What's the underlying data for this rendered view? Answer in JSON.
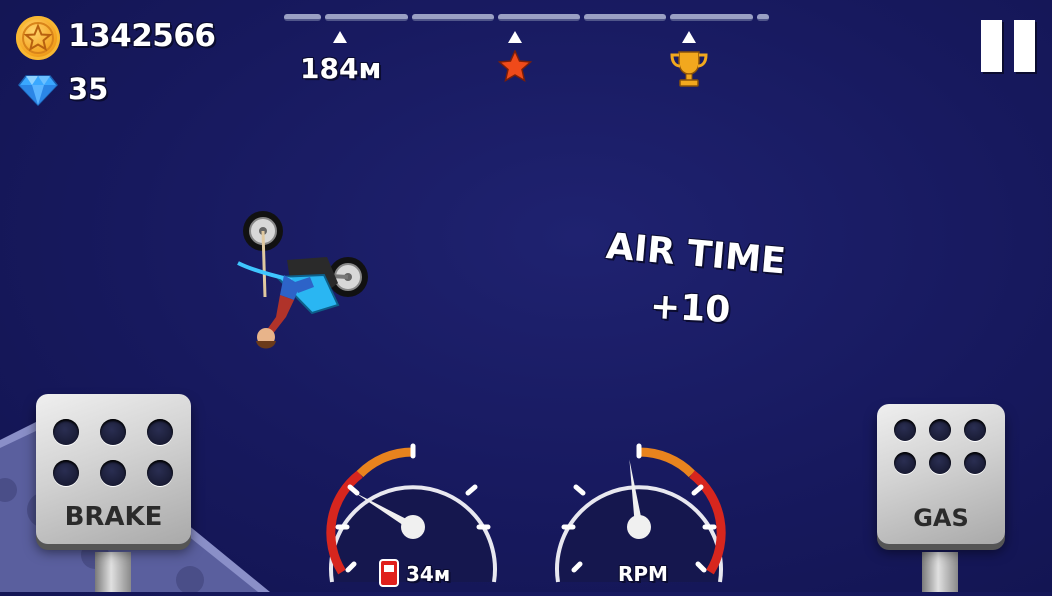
{
  "hud": {
    "coins": "1342566",
    "gems": "35",
    "distance": "184м",
    "fuel_distance": "34м",
    "rpm_label": "RPM"
  },
  "popup": {
    "title": "AIR TIME",
    "points": "+10"
  },
  "controls": {
    "brake_label": "BRAKE",
    "gas_label": "GAS"
  },
  "icons": {
    "coin": "star-coin-icon",
    "gem": "diamond-icon",
    "progress_marker": "triangle-up-icon",
    "star_marker": "star-icon",
    "trophy_marker": "trophy-icon",
    "pause": "pause-icon",
    "fuel": "fuel-can-icon"
  },
  "colors": {
    "background": "#17195e",
    "coin": "#f4a21e",
    "gem": "#3aa8ff",
    "star": "#f04a1a",
    "trophy": "#f2a81e",
    "gauge_accent": "#e8831e",
    "gauge_red": "#d7261e"
  },
  "gauges": {
    "speed_needle_fraction": 0.28,
    "rpm_needle_fraction": 0.47
  }
}
